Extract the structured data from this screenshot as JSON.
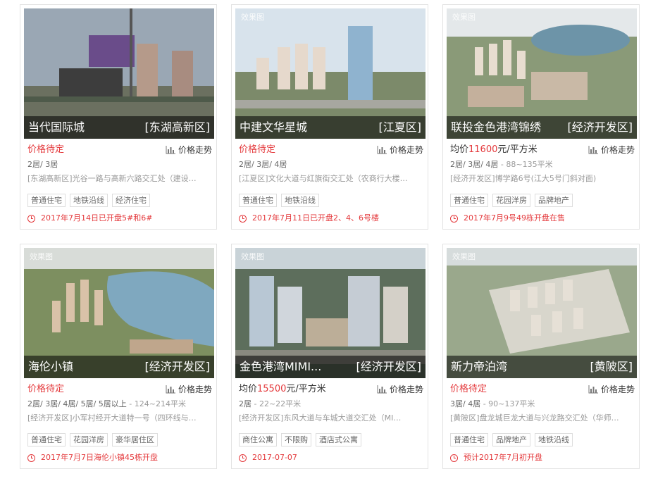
{
  "colors": {
    "accent": "#e4393c",
    "muted": "#999999",
    "border": "#e3e3e3"
  },
  "trend_label": "价格走势",
  "trend_icon": "bar-chart-icon",
  "clock_icon": "clock-icon",
  "cards": [
    {
      "watermark": "",
      "name": "当代国际城",
      "district": "[东湖高新区]",
      "price_pending": "价格待定",
      "price_prefix": "",
      "price_value": "",
      "price_unit": "",
      "rooms": "2居/ 3居",
      "area": "",
      "address": "[东湖高新区]光谷一路与高新六路交汇处（建设…",
      "tags": [
        "普通住宅",
        "地铁沿线",
        "经济住宅"
      ],
      "open": "2017年7月14日已开盘5#和6#"
    },
    {
      "watermark": "效果图",
      "name": "中建文华星城",
      "district": "[江夏区]",
      "price_pending": "价格待定",
      "price_prefix": "",
      "price_value": "",
      "price_unit": "",
      "rooms": "2居/ 3居/ 4居",
      "area": "",
      "address": "[江夏区]文化大道与红旗街交汇处（农商行大楼…",
      "tags": [
        "普通住宅",
        "地铁沿线"
      ],
      "open": "2017年7月11日已开盘2、4、6号楼"
    },
    {
      "watermark": "效果图",
      "name": "联投金色港湾锦绣",
      "district": "[经济开发区]",
      "price_pending": "",
      "price_prefix": "均价",
      "price_value": "11600",
      "price_unit": "元/平方米",
      "rooms": "2居/ 3居/ 4居",
      "area": " - 88~135平米",
      "address": "[经济开发区]博学路6号(江大5号门斜对面)",
      "tags": [
        "普通住宅",
        "花园洋房",
        "品牌地产"
      ],
      "open": "2017年7月9号49栋开盘在售"
    },
    {
      "watermark": "效果图",
      "name": "海伦小镇",
      "district": "[经济开发区]",
      "price_pending": "价格待定",
      "price_prefix": "",
      "price_value": "",
      "price_unit": "",
      "rooms": "2居/ 3居/ 4居/ 5居/ 5居以上",
      "area": " - 124~214平米",
      "address": "[经济开发区]小军村经开大道特一号（四环线与…",
      "tags": [
        "普通住宅",
        "花园洋房",
        "豪华居住区"
      ],
      "open": "2017年7月7日海伦小镇45栋开盘"
    },
    {
      "watermark": "效果图",
      "name": "金色港湾MIMI...",
      "district": "[经济开发区]",
      "price_pending": "",
      "price_prefix": "均价",
      "price_value": "15500",
      "price_unit": "元/平方米",
      "rooms": "2居",
      "area": " - 22~22平米",
      "address": "[经济开发区]东风大道与车城大道交汇处（MI…",
      "tags": [
        "商住公寓",
        "不限购",
        "酒店式公寓"
      ],
      "open": "2017-07-07"
    },
    {
      "watermark": "效果图",
      "name": "新力帝泊湾",
      "district": "[黄陂区]",
      "price_pending": "价格待定",
      "price_prefix": "",
      "price_value": "",
      "price_unit": "",
      "rooms": "3居/ 4居",
      "area": " - 90~137平米",
      "address": "[黄陂区]盘龙城巨龙大道与兴龙路交汇处（华师…",
      "tags": [
        "普通住宅",
        "品牌地产",
        "地铁沿线"
      ],
      "open": "预计2017年7月初开盘"
    }
  ]
}
